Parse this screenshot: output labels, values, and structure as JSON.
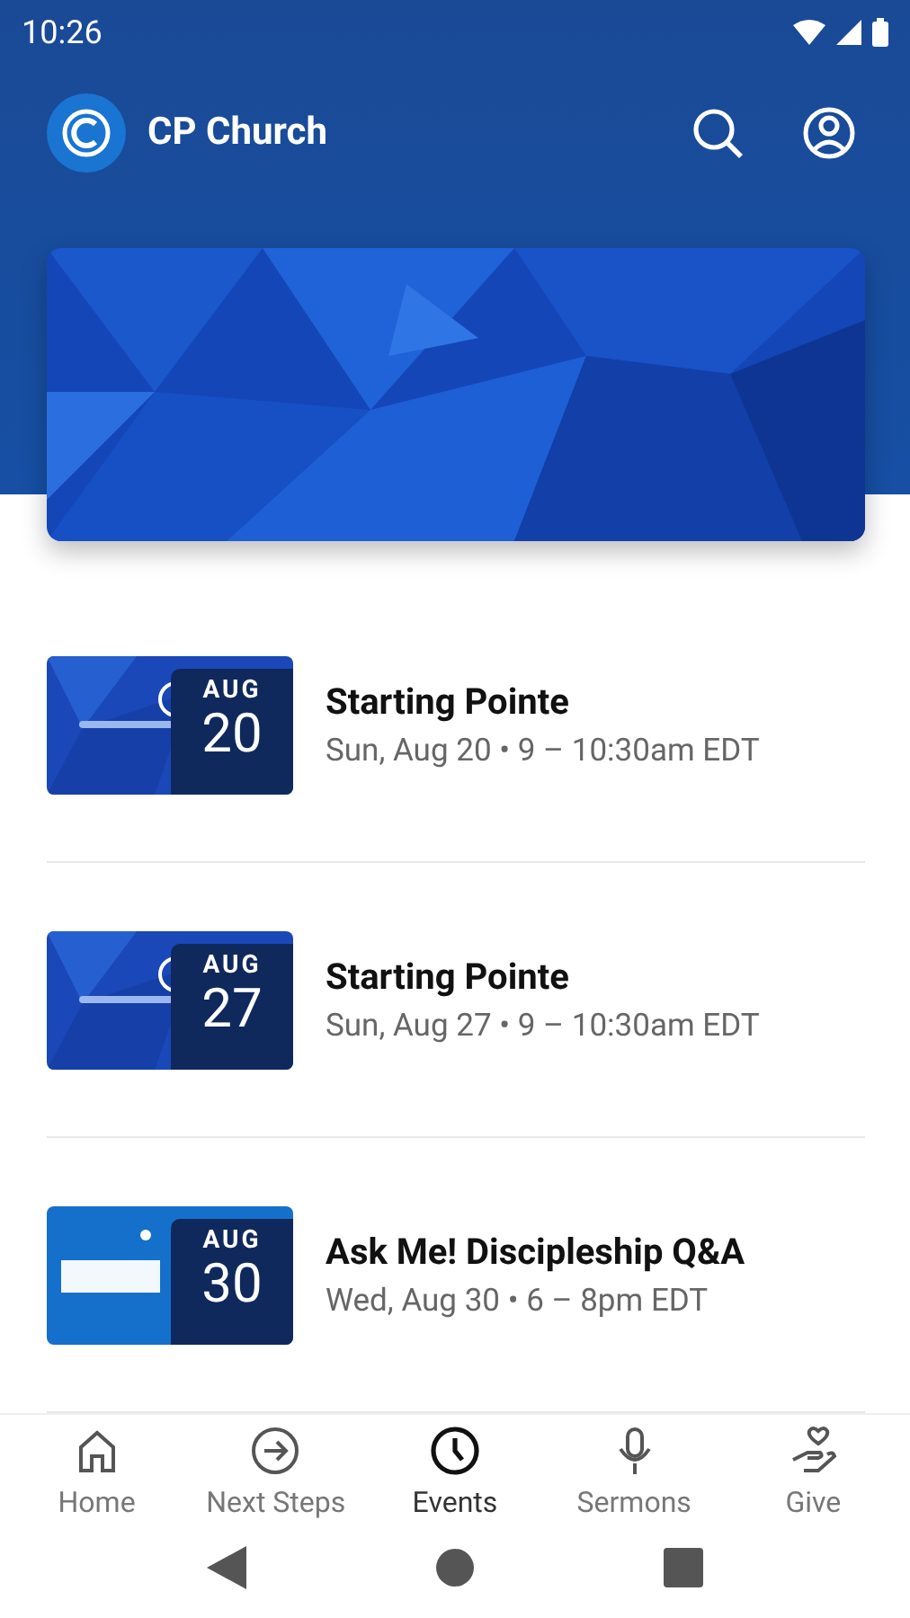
{
  "status_bar": {
    "time": "10:26"
  },
  "app_bar": {
    "title": "CP Church"
  },
  "events": [
    {
      "kind": "picture",
      "month": "AUG",
      "day": "20",
      "title": "Starting Pointe",
      "when": "Sun, Aug 20 • 9 – 10:30am EDT"
    },
    {
      "kind": "picture",
      "month": "AUG",
      "day": "27",
      "title": "Starting Pointe",
      "when": "Sun, Aug 27 • 9 – 10:30am EDT"
    },
    {
      "kind": "picture",
      "month": "AUG",
      "day": "30",
      "title": "Ask Me! Discipleship Q&A",
      "when": "Wed, Aug 30 • 6 – 8pm EDT"
    }
  ],
  "nav": [
    {
      "label": "Home",
      "selected": false
    },
    {
      "label": "Next Steps",
      "selected": false
    },
    {
      "label": "Events",
      "selected": true
    },
    {
      "label": "Sermons",
      "selected": false
    },
    {
      "label": "Give",
      "selected": false
    }
  ]
}
